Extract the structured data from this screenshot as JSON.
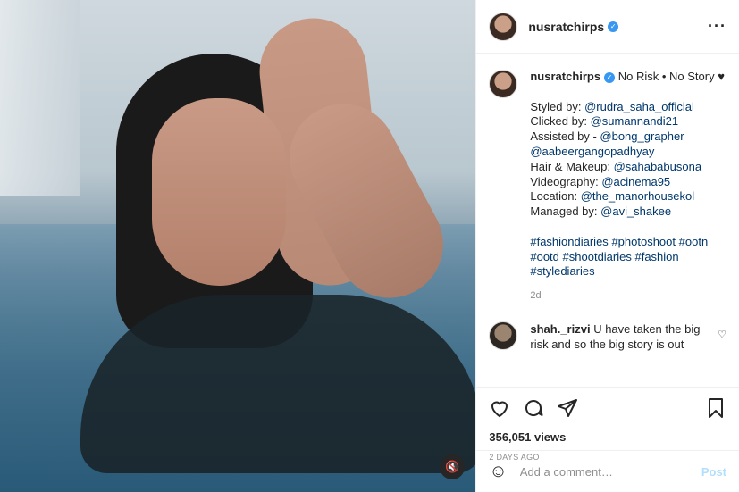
{
  "post": {
    "username": "nusratchirps",
    "verified_icon": "verified-badge-icon",
    "more_icon": "more-options-icon",
    "caption_title": "No Risk • No Story ♥",
    "caption_lines": [
      {
        "label": "Styled by: ",
        "handle": "@rudra_saha_official"
      },
      {
        "label": "Clicked by: ",
        "handle": "@sumannandi21"
      },
      {
        "label": "Assisted by - ",
        "handle": "@bong_grapher"
      },
      {
        "label": "",
        "handle": "@aabeergangopadhyay"
      },
      {
        "label": "Hair & Makeup: ",
        "handle": "@sahababusona"
      },
      {
        "label": "Videography: ",
        "handle": "@acinema95"
      },
      {
        "label": "Location: ",
        "handle": "@the_manorhousekol"
      },
      {
        "label": "Managed by: ",
        "handle": "@avi_shakee"
      }
    ],
    "hashtags": [
      "#fashiondiaries",
      "#photoshoot",
      "#ootn",
      "#ootd",
      "#shootdiaries",
      "#fashion",
      "#stylediaries"
    ],
    "caption_time": "2d",
    "comment": {
      "username": "shah._rizvi",
      "text": "U have taken the big risk and so the big story is out"
    },
    "views": "356,051 views",
    "posted_ago": "2 DAYS AGO",
    "add_comment_placeholder": "Add a comment…",
    "post_button": "Post"
  },
  "colors": {
    "link": "#00376b",
    "verified": "#3897f0",
    "post_button": "#b2dffc",
    "muted": "#8e8e8e"
  }
}
